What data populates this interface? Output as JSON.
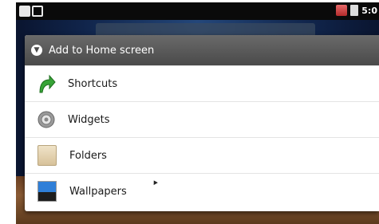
{
  "status_bar": {
    "time": "5:0",
    "icons": [
      "notification-icon",
      "sd-card-icon",
      "camera-icon",
      "battery-icon"
    ]
  },
  "dialog": {
    "title": "Add to Home screen",
    "title_icon": "chevron-down-icon",
    "items": [
      {
        "label": "Shortcuts",
        "icon": "shortcut-arrow-icon"
      },
      {
        "label": "Widgets",
        "icon": "widget-gear-icon"
      },
      {
        "label": "Folders",
        "icon": "folder-icon"
      },
      {
        "label": "Wallpapers",
        "icon": "wallpaper-icon"
      }
    ]
  },
  "colors": {
    "title_bar": "#4a4a4a",
    "shortcut_arrow": "#2f9a2f",
    "wallpaper_sky": "#10244a"
  }
}
